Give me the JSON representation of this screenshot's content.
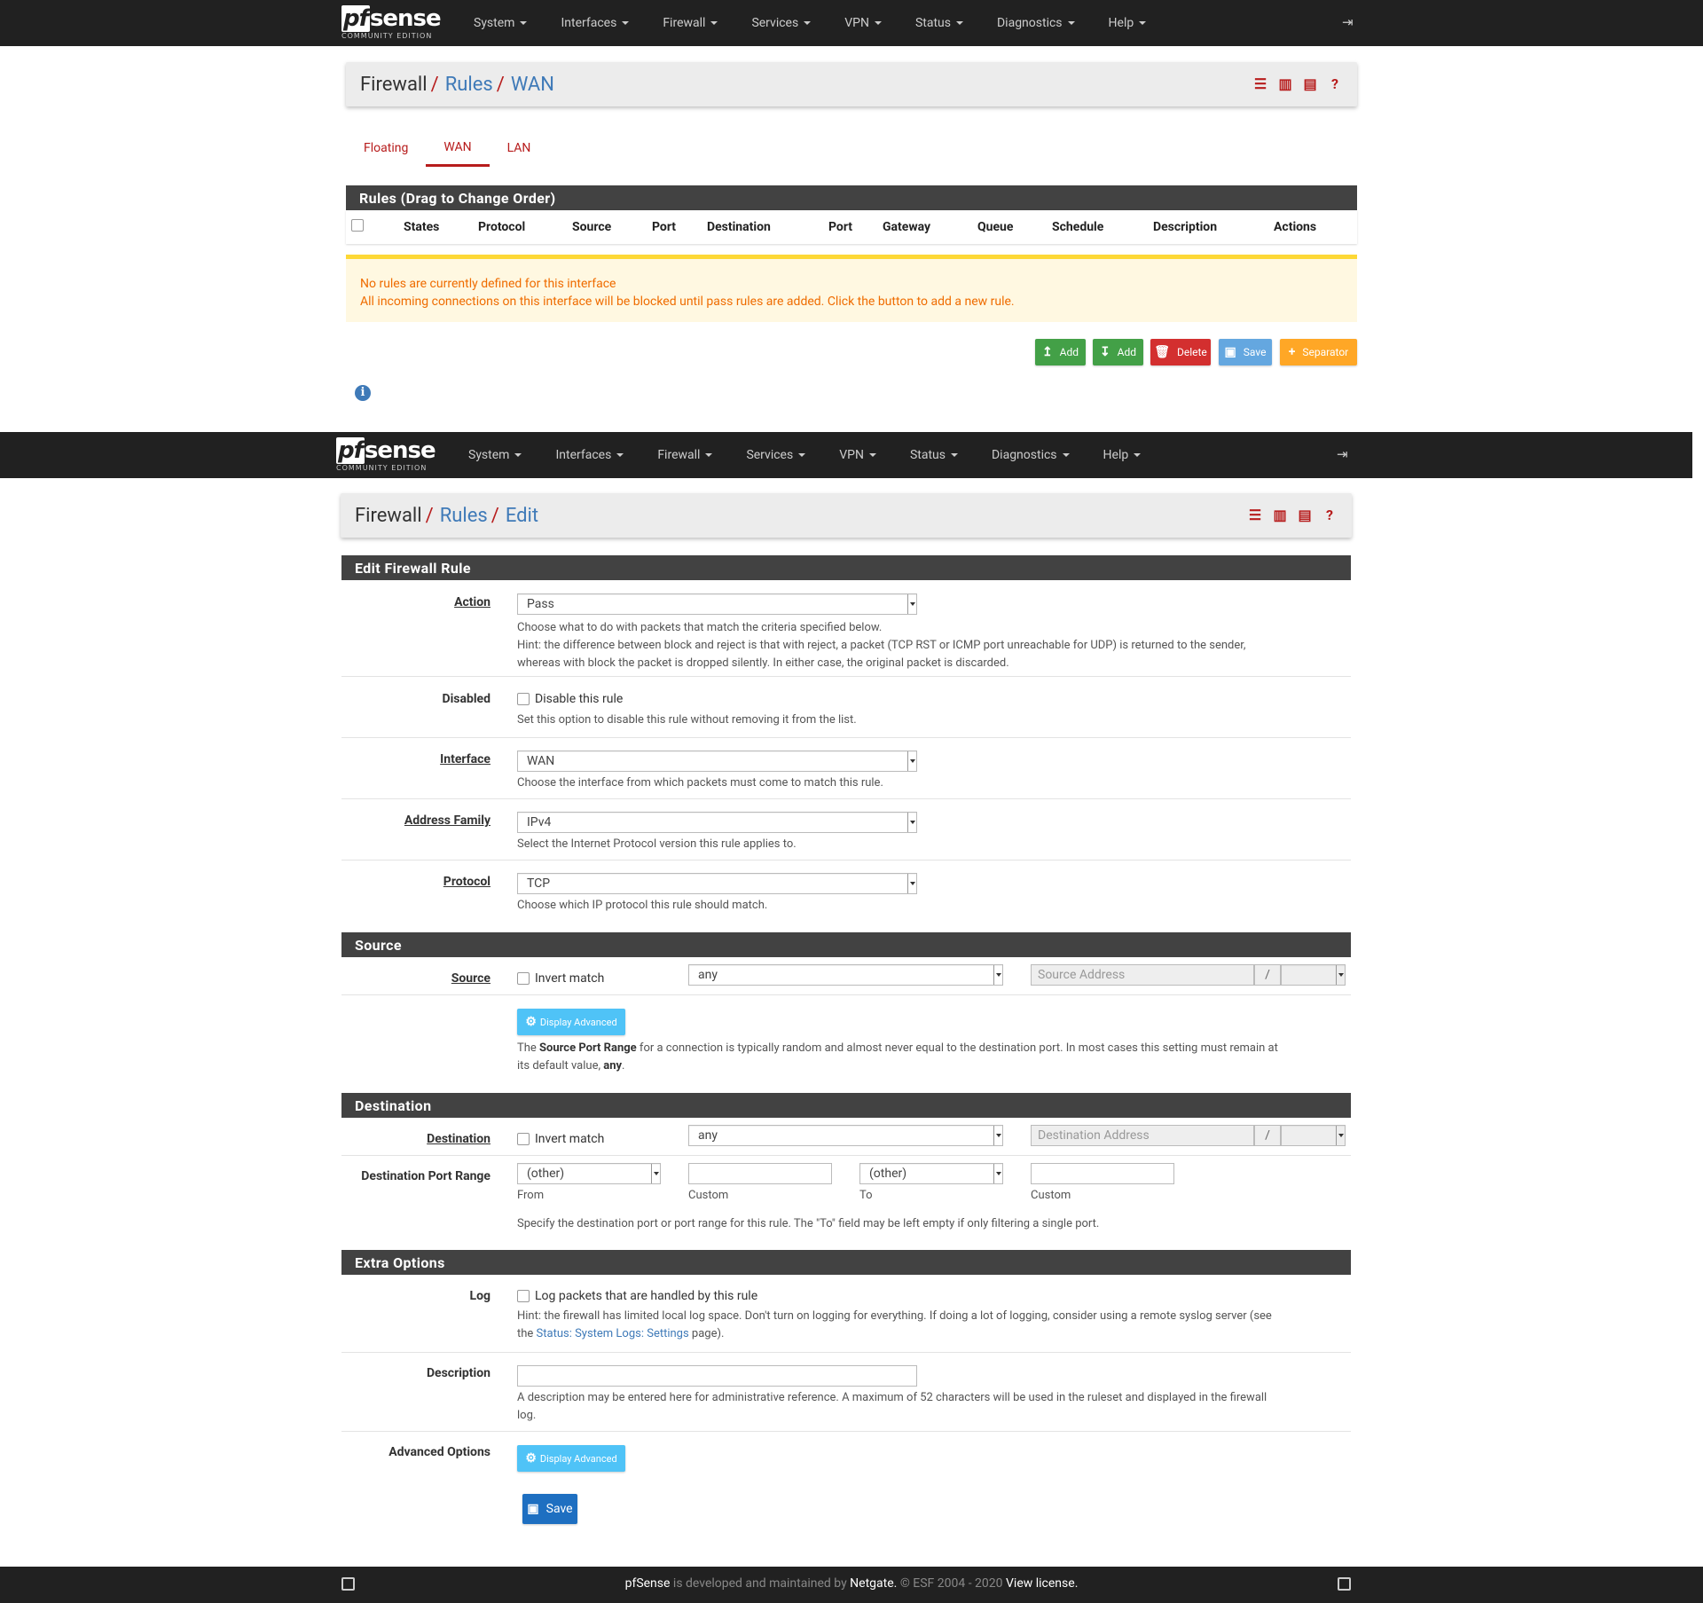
{
  "brand": {
    "name": "sense",
    "prefix": "pf",
    "edition": "COMMUNITY EDITION"
  },
  "nav": [
    "System",
    "Interfaces",
    "Firewall",
    "Services",
    "VPN",
    "Status",
    "Diagnostics",
    "Help"
  ],
  "page1": {
    "breadcrumb": {
      "root": "Firewall",
      "l1": "Rules",
      "l2": "WAN"
    },
    "tabs": [
      "Floating",
      "WAN",
      "LAN"
    ],
    "active_tab": "WAN",
    "table_title": "Rules (Drag to Change Order)",
    "columns": [
      "States",
      "Protocol",
      "Source",
      "Port",
      "Destination",
      "Port",
      "Gateway",
      "Queue",
      "Schedule",
      "Description",
      "Actions"
    ],
    "warning_line1": "No rules are currently defined for this interface",
    "warning_line2": "All incoming connections on this interface will be blocked until pass rules are added. Click the button to add a new rule.",
    "buttons": {
      "add_top": "Add",
      "add_bottom": "Add",
      "delete": "Delete",
      "save": "Save",
      "separator": "Separator"
    }
  },
  "page2": {
    "breadcrumb": {
      "root": "Firewall",
      "l1": "Rules",
      "l2": "Edit"
    },
    "sections": {
      "edit": "Edit Firewall Rule",
      "source": "Source",
      "destination": "Destination",
      "extra": "Extra Options"
    },
    "action": {
      "label": "Action",
      "value": "Pass",
      "help1": "Choose what to do with packets that match the criteria specified below.",
      "help2": "Hint: the difference between block and reject is that with reject, a packet (TCP RST or ICMP port unreachable for UDP) is returned to the sender,",
      "help3": "whereas with block the packet is dropped silently. In either case, the original packet is discarded."
    },
    "disabled": {
      "label": "Disabled",
      "check": "Disable this rule",
      "help": "Set this option to disable this rule without removing it from the list."
    },
    "interface": {
      "label": "Interface",
      "value": "WAN",
      "help": "Choose the interface from which packets must come to match this rule."
    },
    "family": {
      "label": "Address Family",
      "value": "IPv4",
      "help": "Select the Internet Protocol version this rule applies to."
    },
    "protocol": {
      "label": "Protocol",
      "value": "TCP",
      "help": "Choose which IP protocol this rule should match."
    },
    "source": {
      "label": "Source",
      "invert": "Invert match",
      "type": "any",
      "address_placeholder": "Source Address",
      "slash": "/",
      "adv_button": "Display Advanced",
      "help_pre": "The ",
      "help_bold": "Source Port Range",
      "help_mid": " for a connection is typically random and almost never equal to the destination port. In most cases this setting must remain at",
      "help_line2_pre": "its default value, ",
      "help_line2_bold": "any",
      "help_line2_post": "."
    },
    "destination": {
      "label": "Destination",
      "invert": "Invert match",
      "type": "any",
      "address_placeholder": "Destination Address",
      "slash": "/",
      "port_label": "Destination Port Range",
      "from_value": "(other)",
      "to_value": "(other)",
      "from": "From",
      "custom1": "Custom",
      "to": "To",
      "custom2": "Custom",
      "help": "Specify the destination port or port range for this rule. The \"To\" field may be left empty if only filtering a single port."
    },
    "log": {
      "label": "Log",
      "check": "Log packets that are handled by this rule",
      "help1": "Hint: the firewall has limited local log space. Don't turn on logging for everything. If doing a lot of logging, consider using a remote syslog server (see",
      "help2_pre": "the ",
      "help2_link": "Status: System Logs: Settings",
      "help2_post": " page)."
    },
    "description": {
      "label": "Description",
      "help1": "A description may be entered here for administrative reference. A maximum of 52 characters will be used in the ruleset and displayed in the firewall",
      "help2": "log."
    },
    "advanced": {
      "label": "Advanced Options",
      "button": "Display Advanced"
    },
    "save": "Save"
  },
  "footer": {
    "name": "pfSense",
    "mid": " is developed and maintained by ",
    "company": "Netgate.",
    "copy": " © ESF 2004 - 2020 ",
    "license": "View license."
  },
  "colors": {
    "navbar": "#212121",
    "accent_red": "#b71c1c",
    "link_blue": "#3f7ab8",
    "panel_head": "#424242",
    "warning_text": "#ef6c00",
    "warning_bg": "#fff8e1"
  }
}
